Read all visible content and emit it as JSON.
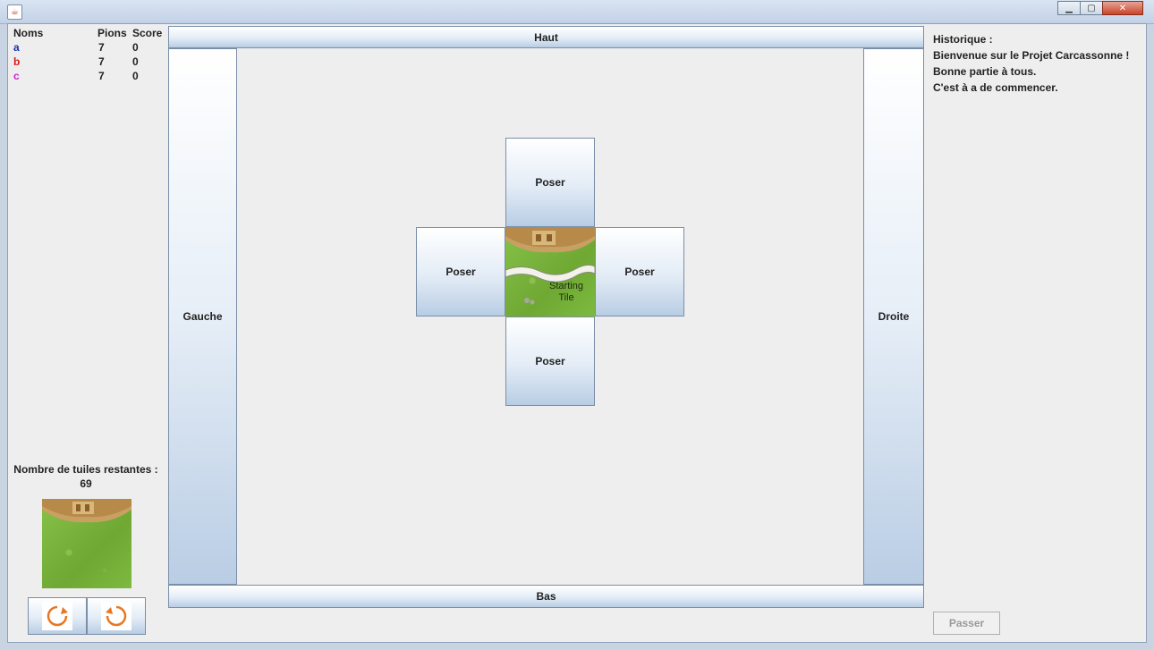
{
  "window": {
    "close_glyph": "✕",
    "minimize_glyph": "▁",
    "maximize_glyph": "▢"
  },
  "players": {
    "headers": {
      "name": "Noms",
      "pions": "Pions",
      "score": "Score"
    },
    "rows": [
      {
        "name": "a",
        "pions": "7",
        "score": "0",
        "color": "#1a2fb0"
      },
      {
        "name": "b",
        "pions": "7",
        "score": "0",
        "color": "#d81b1b"
      },
      {
        "name": "c",
        "pions": "7",
        "score": "0",
        "color": "#d21fd2"
      }
    ]
  },
  "nav": {
    "top": "Haut",
    "bottom": "Bas",
    "left": "Gauche",
    "right": "Droite"
  },
  "board": {
    "place_top": "Poser",
    "place_left": "Poser",
    "place_right": "Poser",
    "place_bottom": "Poser",
    "starting_tile_line1": "Starting",
    "starting_tile_line2": "Tile"
  },
  "tiles_remaining": {
    "label": "Nombre de tuiles restantes :",
    "count": "69"
  },
  "history": {
    "title": "Historique :",
    "lines": [
      "Bienvenue sur le Projet Carcassonne !",
      "Bonne partie à tous.",
      "C'est à a de commencer."
    ]
  },
  "actions": {
    "pass": "Passer"
  },
  "colors": {
    "accent_orange": "#e87722",
    "button_blue": "#b8cde4"
  }
}
